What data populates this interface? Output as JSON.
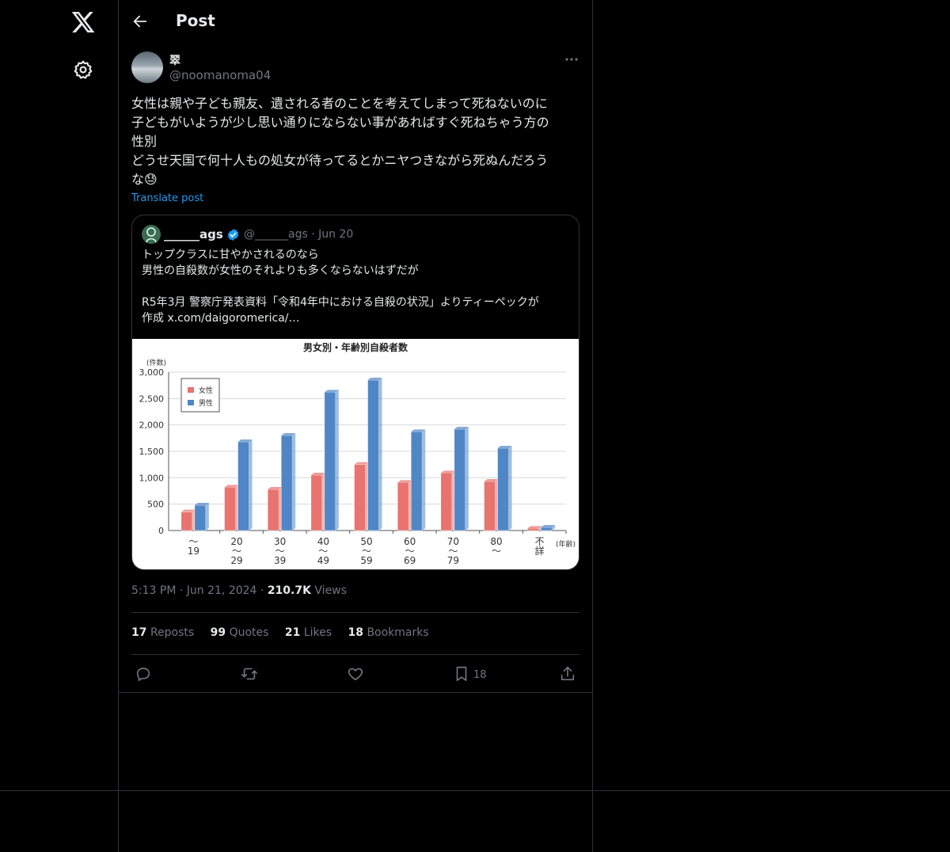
{
  "header": {
    "title": "Post"
  },
  "post": {
    "display_name": "翠",
    "handle": "@noomanoma04",
    "lines": [
      "女性は親や子ども親友、遺される者のことを考えてしまって死ねないのに",
      "子どもがいようが少し思い通りにならない事があればすぐ死ねちゃう方の",
      "性別",
      "どうせ天国で何十人もの処女が待ってるとかニヤつきながら死ぬんだろう",
      "な😓"
    ],
    "translate_label": "Translate post",
    "time": "5:13 PM",
    "date": "Jun 21, 2024",
    "views_count": "210.7K",
    "views_label": "Views"
  },
  "quote": {
    "display_name": "______ags",
    "handle_date": "@______ags · Jun 20",
    "lines": [
      "トップクラスに甘やかされるのなら",
      "男性の自殺数が女性のそれよりも多くならないはずだが",
      "",
      "R5年3月 警察庁発表資料「令和4年中における自殺の状況」よりティーペックが",
      "作成  x.com/daigoromerica/…"
    ]
  },
  "stats": {
    "reposts_count": "17",
    "reposts_label": "Reposts",
    "quotes_count": "99",
    "quotes_label": "Quotes",
    "likes_count": "21",
    "likes_label": "Likes",
    "bookmarks_count": "18",
    "bookmarks_label": "Bookmarks"
  },
  "actions": {
    "bookmark_count": "18"
  },
  "icons": [
    "x-logo-icon",
    "settings-gear-icon",
    "back-arrow-icon",
    "more-icon",
    "verified-badge-icon",
    "reply-icon",
    "repost-icon",
    "like-icon",
    "bookmark-icon",
    "share-icon"
  ],
  "colors": {
    "accent": "#1d9bf0",
    "female_bar": "#e8736f",
    "male_bar": "#4f86c6"
  },
  "chart_data": {
    "type": "bar",
    "title": "男女別・年齢別自殺者数",
    "ylabel": "(件数)",
    "xlabel": "(年齢)",
    "ylim": [
      0,
      3000
    ],
    "yticks": [
      "0",
      "500",
      "1,000",
      "1,500",
      "2,000",
      "2,500",
      "3,000"
    ],
    "categories": [
      [
        "～",
        "19"
      ],
      [
        "20",
        "～",
        "29"
      ],
      [
        "30",
        "～",
        "39"
      ],
      [
        "40",
        "～",
        "49"
      ],
      [
        "50",
        "～",
        "59"
      ],
      [
        "60",
        "～",
        "69"
      ],
      [
        "70",
        "～",
        "79"
      ],
      [
        "80",
        "～"
      ],
      [
        "不",
        "詳"
      ]
    ],
    "series": [
      {
        "name": "女性",
        "color": "#e8736f",
        "values": [
          350,
          820,
          780,
          1050,
          1250,
          910,
          1090,
          930,
          40
        ]
      },
      {
        "name": "男性",
        "color": "#4f86c6",
        "values": [
          480,
          1680,
          1800,
          2620,
          2850,
          1870,
          1920,
          1560,
          60
        ]
      }
    ],
    "legend": "top-left",
    "grid": true
  }
}
